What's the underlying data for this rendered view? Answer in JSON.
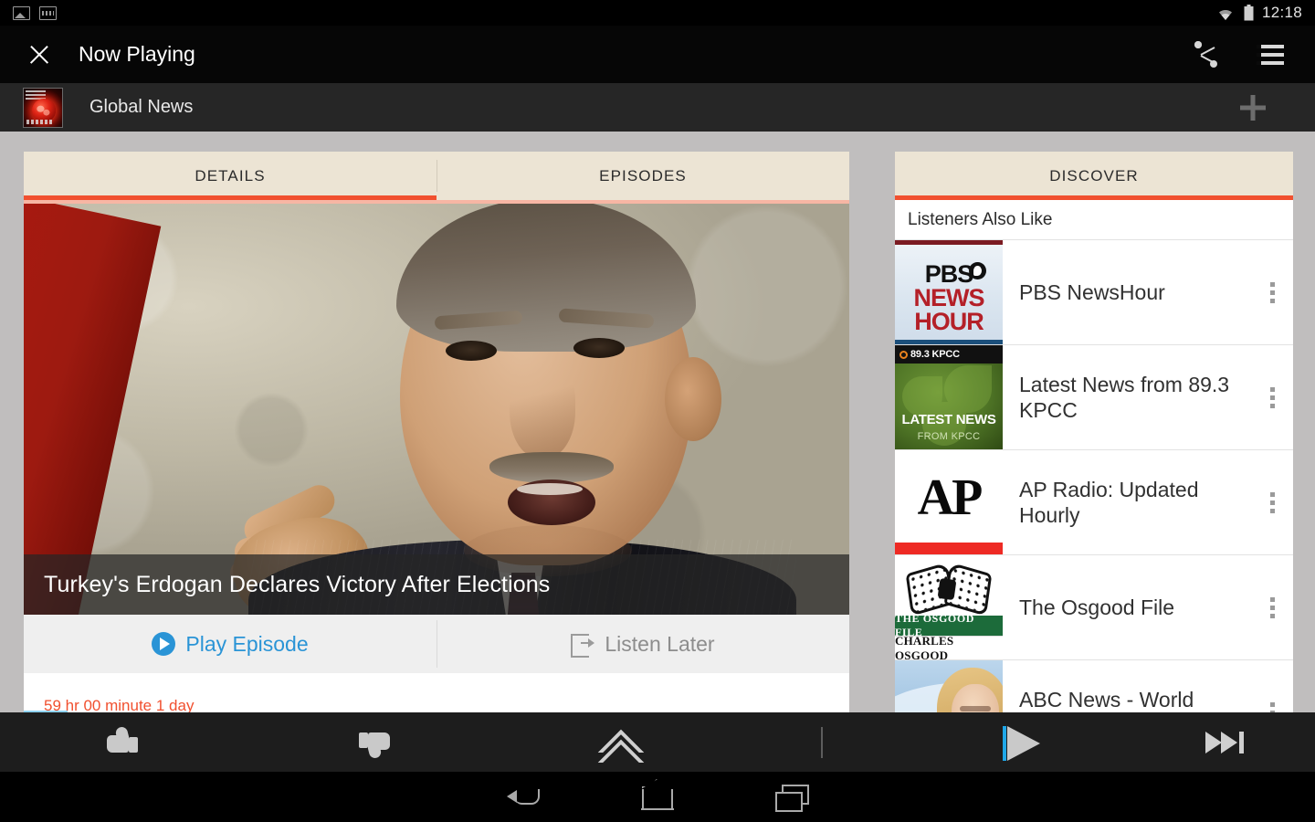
{
  "statusbar": {
    "time": "12:18",
    "icons": [
      "photo-icon",
      "film-strip-icon",
      "wifi-icon",
      "battery-icon"
    ]
  },
  "actionbar": {
    "title": "Now Playing",
    "close_label": "Close",
    "share_label": "Share",
    "menu_label": "Playlist"
  },
  "podcast": {
    "name": "Global News",
    "artwork_label": "BBC World Service Global News",
    "add_label": "Add"
  },
  "left_panel": {
    "tabs": [
      {
        "label": "DETAILS",
        "active": true
      },
      {
        "label": "EPISODES",
        "active": false
      }
    ],
    "episode_title": "Turkey's Erdogan Declares Victory After Elections",
    "actions": [
      {
        "label": "Play Episode",
        "icon": "play-circle-icon",
        "color": "#2a94d6"
      },
      {
        "label": "Listen Later",
        "icon": "listen-later-icon",
        "color": "#8d8d8d"
      }
    ],
    "meta_text": "59 hr 00 minute 1 day"
  },
  "right_panel": {
    "tab_label": "DISCOVER",
    "section_title": "Listeners Also Like",
    "items": [
      {
        "title": "PBS NewsHour",
        "art": "pbs",
        "art_lines": [
          "PBS",
          "NEWS",
          "HOUR"
        ]
      },
      {
        "title": "Latest News from 89.3 KPCC",
        "art": "kpcc",
        "art_lines": [
          "89.3 KPCC",
          "LATEST NEWS",
          "FROM KPCC"
        ]
      },
      {
        "title": "AP Radio: Updated Hourly",
        "art": "ap",
        "art_lines": [
          "AP"
        ]
      },
      {
        "title": "The Osgood File",
        "art": "osgood",
        "art_lines": [
          "THE OSGOOD FILE",
          "CHARLES OSGOOD"
        ]
      },
      {
        "title": "ABC News - World News",
        "art": "abc",
        "art_lines": []
      }
    ],
    "overflow_label": "More options"
  },
  "player": {
    "controls": [
      {
        "name": "thumbs-up",
        "label": "Thumbs Up"
      },
      {
        "name": "thumbs-down",
        "label": "Thumbs Down"
      },
      {
        "name": "chevron-up",
        "label": "Expand"
      },
      {
        "name": "play",
        "label": "Play"
      },
      {
        "name": "skip",
        "label": "Skip"
      }
    ]
  },
  "navbar": {
    "back_label": "Back",
    "home_label": "Home",
    "recents_label": "Recent apps"
  },
  "colors": {
    "accent_orange": "#f1502f",
    "tab_cream": "#ece4d4",
    "page_gray": "#c0bebe",
    "play_blue": "#2a94d6"
  }
}
